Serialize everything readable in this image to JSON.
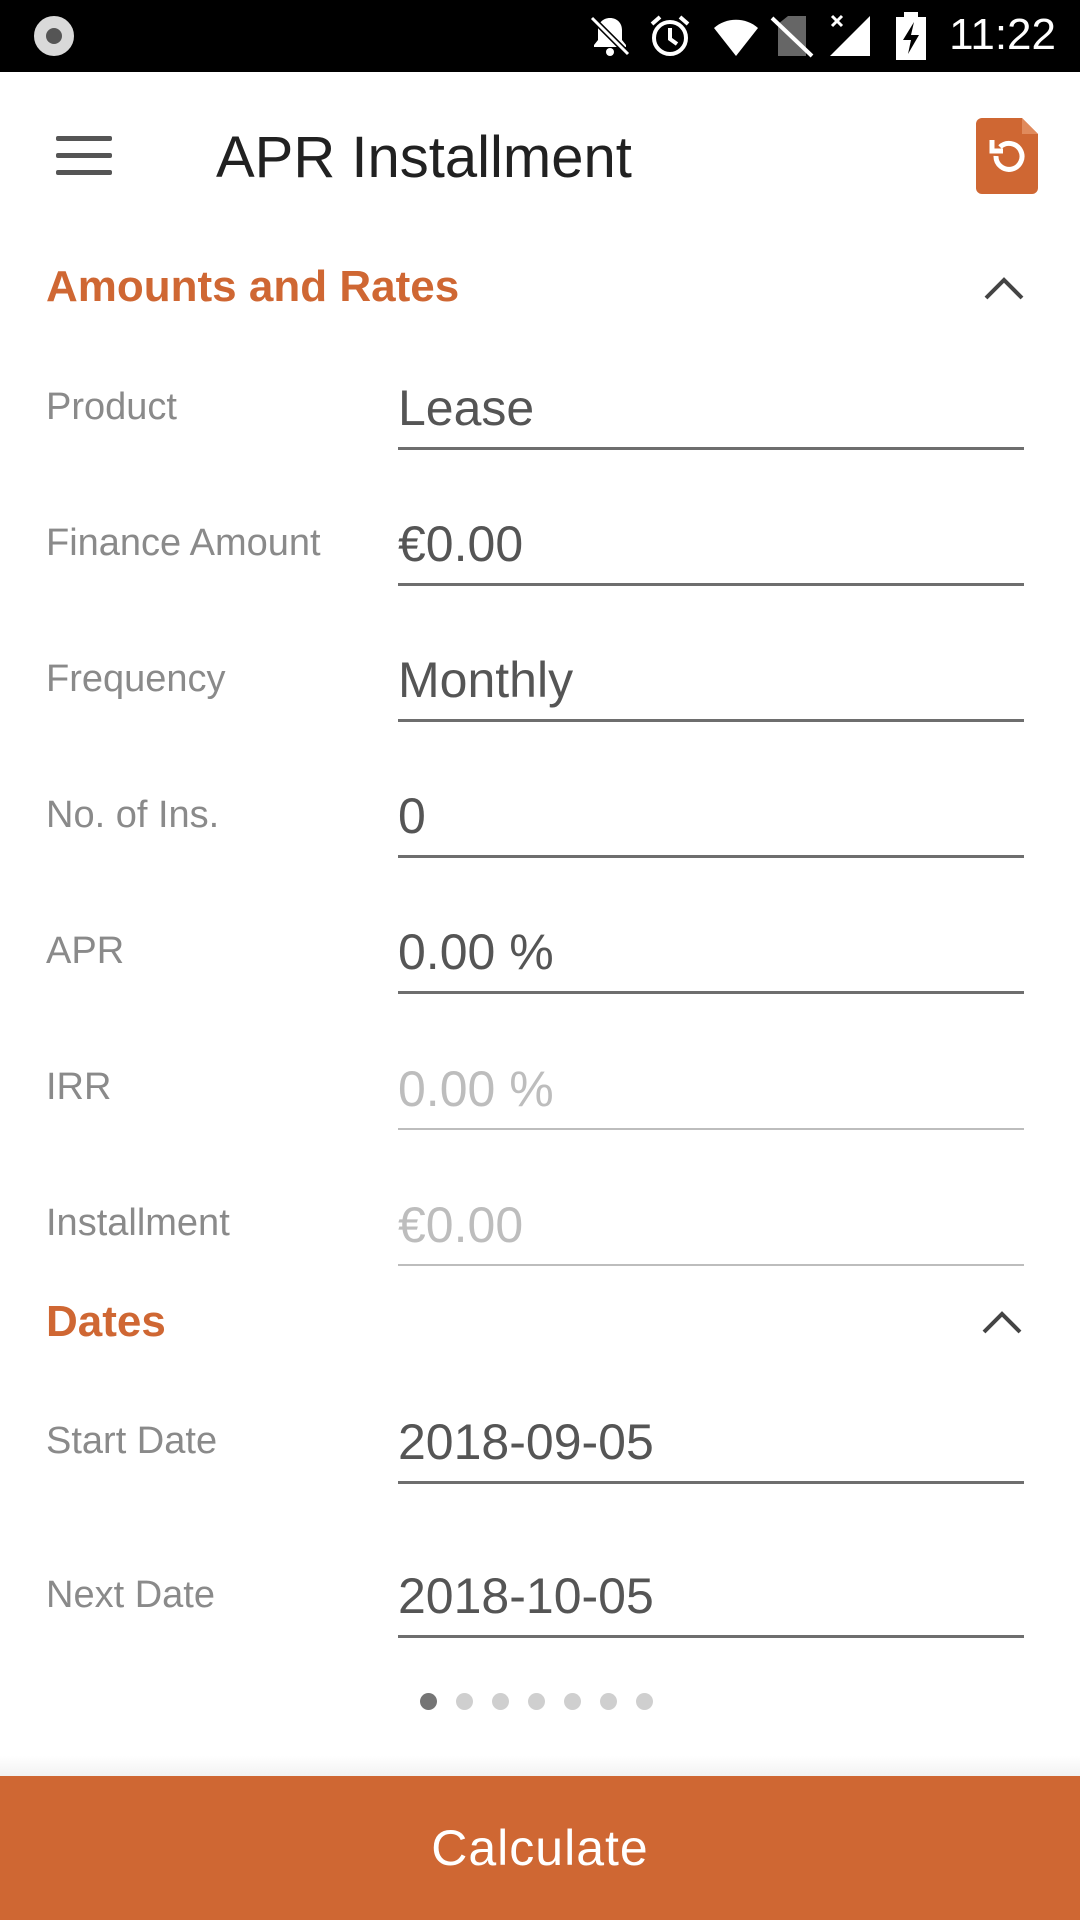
{
  "status_bar": {
    "time": "11:22",
    "icons": [
      "record-icon",
      "notifications-off-icon",
      "alarm-icon",
      "wifi-icon",
      "no-sim-icon",
      "signal-off-icon",
      "battery-charging-icon"
    ]
  },
  "app_bar": {
    "title": "APR Installment",
    "menu_icon": "hamburger-menu-icon",
    "reset_icon": "reset-document-icon"
  },
  "sections": {
    "amounts": {
      "title": "Amounts and Rates",
      "fields": {
        "product": {
          "label": "Product",
          "value": "Lease"
        },
        "finance_amount": {
          "label": "Finance Amount",
          "value": "€0.00"
        },
        "frequency": {
          "label": "Frequency",
          "value": "Monthly"
        },
        "no_of_ins": {
          "label": "No. of Ins.",
          "value": "0"
        },
        "apr": {
          "label": "APR",
          "value": "0.00 %"
        },
        "irr": {
          "label": "IRR",
          "value": "0.00 %"
        },
        "installment": {
          "label": "Installment",
          "value": "€0.00"
        }
      }
    },
    "dates": {
      "title": "Dates",
      "fields": {
        "start_date": {
          "label": "Start Date",
          "value": "2018-09-05"
        },
        "next_date": {
          "label": "Next Date",
          "value": "2018-10-05"
        }
      }
    }
  },
  "pager": {
    "count": 7,
    "active": 1
  },
  "actions": {
    "calculate_label": "Calculate"
  },
  "colors": {
    "accent": "#cf6733",
    "label": "#8a8a8a",
    "value": "#555555",
    "disabled": "#bdbdbd"
  }
}
